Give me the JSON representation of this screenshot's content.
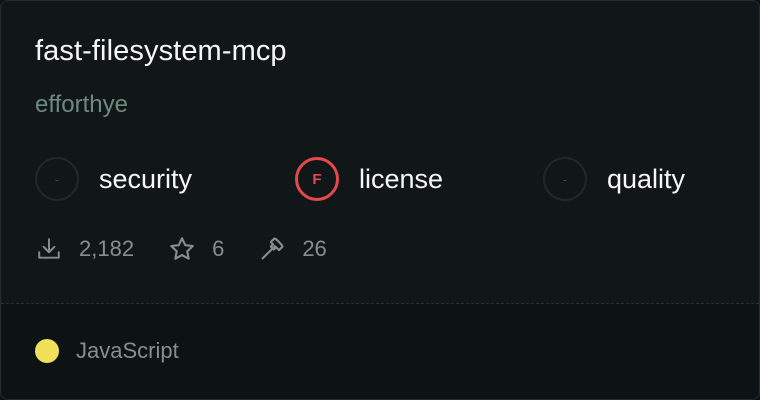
{
  "package": {
    "name": "fast-filesystem-mcp",
    "owner": "efforthye"
  },
  "scores": [
    {
      "badge": "-",
      "label": "security",
      "status": "none"
    },
    {
      "badge": "F",
      "label": "license",
      "status": "fail"
    },
    {
      "badge": "-",
      "label": "quality",
      "status": "none"
    }
  ],
  "stats": {
    "downloads": "2,182",
    "stars": "6",
    "tools": "26",
    "icons": [
      "download-icon",
      "star-icon",
      "hammer-icon"
    ]
  },
  "language": {
    "name": "JavaScript",
    "color": "#f1e05a"
  },
  "colors": {
    "fail": "#e5484d",
    "owner": "#6d8a7d"
  }
}
